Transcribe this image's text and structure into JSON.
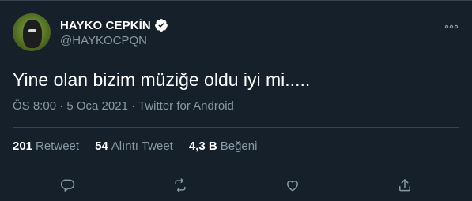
{
  "user": {
    "display_name": "HAYKO CEPKİN",
    "handle": "@HAYKOCPQN",
    "verified": true
  },
  "tweet": {
    "text": "Yine olan bizim müziğe oldu iyi mi.....",
    "meta": "ÖS 8:00 · 5 Oca 2021 · Twitter for Android"
  },
  "stats": [
    {
      "count": "201",
      "label": "Retweet"
    },
    {
      "count": "54",
      "label": "Alıntı Tweet"
    },
    {
      "count": "4,3 B",
      "label": "Beğeni"
    }
  ],
  "icons": {
    "verified": "verified-badge-icon",
    "more": "more-options-icon",
    "reply": "reply-icon",
    "retweet": "retweet-icon",
    "like": "heart-icon",
    "share": "share-icon"
  },
  "colors": {
    "background": "#15202b",
    "text_primary": "#ffffff",
    "text_secondary": "#8899a6",
    "divider": "#38444d"
  }
}
